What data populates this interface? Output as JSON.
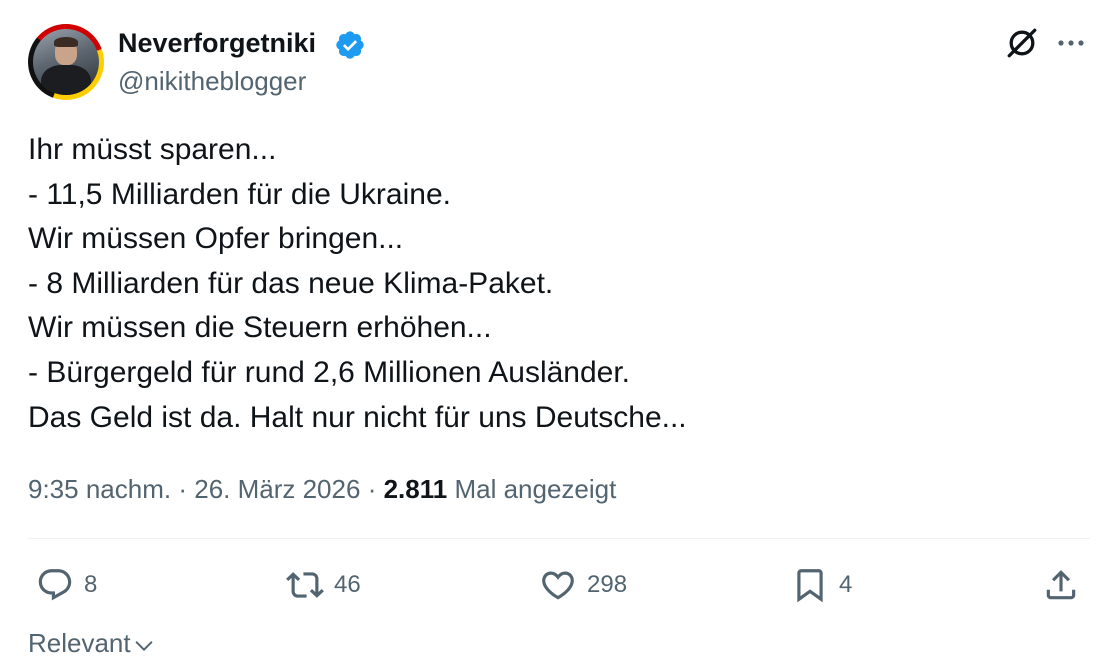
{
  "author": {
    "display_name": "Neverforgetniki",
    "handle": "@nikitheblogger",
    "verified": true,
    "verified_color": "#1d9bf0"
  },
  "tweet": {
    "lines": [
      "Ihr müsst sparen...",
      "- 11,5 Milliarden für die Ukraine.",
      "Wir müssen Opfer bringen...",
      "- 8 Milliarden für das neue Klima-Paket.",
      "Wir müssen die Steuern erhöhen...",
      "- Bürgergeld für rund 2,6 Millionen Ausländer.",
      "Das Geld ist da. Halt nur nicht für uns Deutsche..."
    ],
    "time": "9:35 nachm.",
    "separator": "·",
    "date": "26. März 2026",
    "views_count": "2.811",
    "views_label": "Mal angezeigt"
  },
  "actions": {
    "replies": "8",
    "retweets": "46",
    "likes": "298",
    "bookmarks": "4"
  },
  "sort": {
    "label": "Relevant"
  },
  "icons": {
    "top_right": [
      "grok-icon",
      "more-icon"
    ],
    "actions": [
      "reply-icon",
      "retweet-icon",
      "like-icon",
      "bookmark-icon",
      "share-icon"
    ]
  },
  "colors": {
    "text": "#0f1419",
    "secondary": "#536471",
    "divider": "#eff3f4"
  }
}
